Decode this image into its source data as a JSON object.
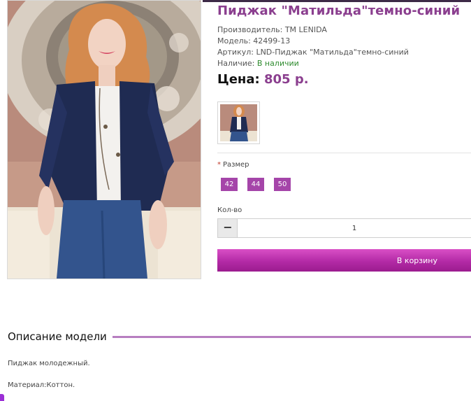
{
  "product": {
    "title": "Пиджак \"Матильда\"темно-синий",
    "manufacturer": "Производитель: TM LENIDA",
    "model": "Модель: 42499-13",
    "article": "Артикул: LND-Пиджак \"Матильда\"темно-синий",
    "availability_label": "Наличие:",
    "availability_value": "В наличии",
    "price_label": "Цена:",
    "price_value": "805 р."
  },
  "options": {
    "size_required_mark": "*",
    "size_label": "Размер",
    "sizes": [
      "42",
      "44",
      "50"
    ]
  },
  "quantity": {
    "label": "Кол-во",
    "minus": "−",
    "value": "1"
  },
  "cart": {
    "button_label": "В корзину"
  },
  "description": {
    "title": "Описание модели",
    "line1": "Пиджак молодежный.",
    "line2": "Материал:Коттон."
  },
  "colors": {
    "accent": "#a545a9",
    "title": "#8b3f8f",
    "in_stock": "#2e8b2e"
  }
}
